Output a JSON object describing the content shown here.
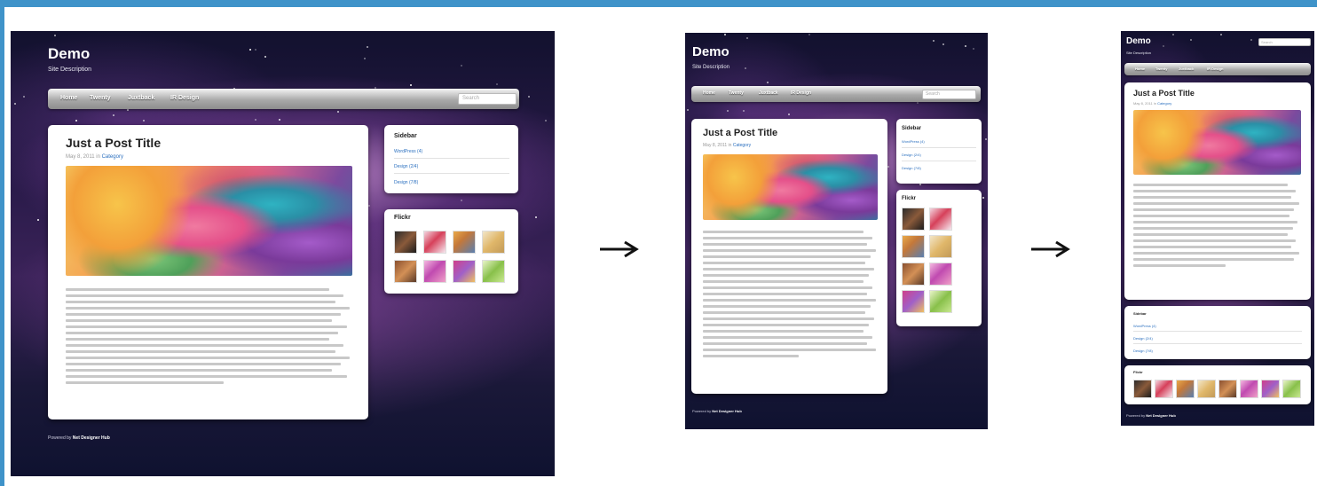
{
  "shots": [
    {
      "site_title": "Demo",
      "site_desc": "Site Description",
      "nav": [
        "Home",
        "Twenty",
        "Juxtback",
        "IR Design"
      ],
      "search_placeholder": "Search",
      "post": {
        "title": "Just a Post Title",
        "date": "May 8, 2011 in",
        "category": "Category"
      },
      "widget1": {
        "title": "Sidebar",
        "links": [
          "WordPress (4)",
          "Design (2/4)",
          "Design (7/8)"
        ]
      },
      "widget2": {
        "title": "Flickr"
      },
      "footer": {
        "prefix": "Powered by",
        "name": "Net Designer Hub"
      }
    },
    {
      "site_title": "Demo",
      "site_desc": "Site Description",
      "nav": [
        "Home",
        "Twenty",
        "Juxtback",
        "IR Design"
      ],
      "search_placeholder": "Search",
      "post": {
        "title": "Just a Post Title",
        "date": "May 8, 2011 in",
        "category": "Category"
      },
      "widget1": {
        "title": "Sidebar",
        "links": [
          "WordPress (4)",
          "Design (2/4)",
          "Design (7/8)"
        ]
      },
      "widget2": {
        "title": "Flickr"
      },
      "footer": {
        "prefix": "Powered by",
        "name": "Net Designer Hub"
      }
    },
    {
      "site_title": "Demo",
      "site_desc": "Site Description",
      "nav": [
        "Home",
        "Twenty",
        "Juxtback",
        "IR Design"
      ],
      "search_placeholder": "Search",
      "post": {
        "title": "Just a Post Title",
        "date": "May 8, 2011 in",
        "category": "Category"
      },
      "widget1": {
        "title": "Sidebar",
        "links": [
          "WordPress (4)",
          "Design (2/4)",
          "Design (7/8)"
        ]
      },
      "widget2": {
        "title": "Flickr"
      },
      "footer": {
        "prefix": "Powered by",
        "name": "Net Designer Hub"
      }
    }
  ],
  "arrows": [
    "arrow-right-icon",
    "arrow-right-icon"
  ],
  "colors": {
    "accent_border": "#3f93c9",
    "link": "#2a6fbf",
    "background_space": "#1a1838"
  }
}
